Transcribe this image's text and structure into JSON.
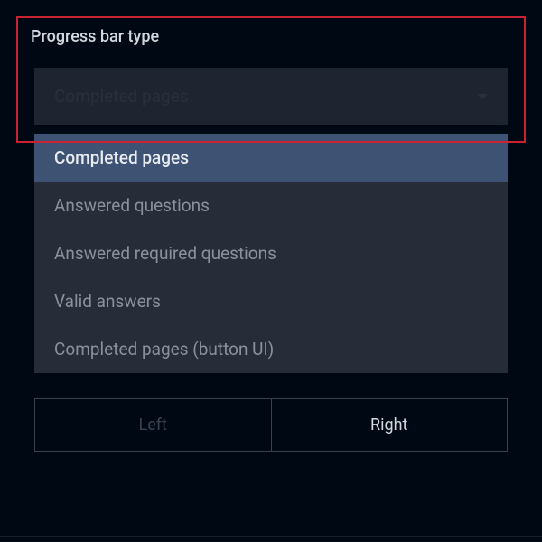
{
  "field": {
    "label": "Progress bar type",
    "selected_value": "Completed pages"
  },
  "options": [
    {
      "label": "Completed pages",
      "selected": true
    },
    {
      "label": "Answered questions",
      "selected": false
    },
    {
      "label": "Answered required questions",
      "selected": false
    },
    {
      "label": "Valid answers",
      "selected": false
    },
    {
      "label": "Completed pages (button UI)",
      "selected": false
    }
  ],
  "segments": {
    "left": "Left",
    "right": "Right"
  }
}
